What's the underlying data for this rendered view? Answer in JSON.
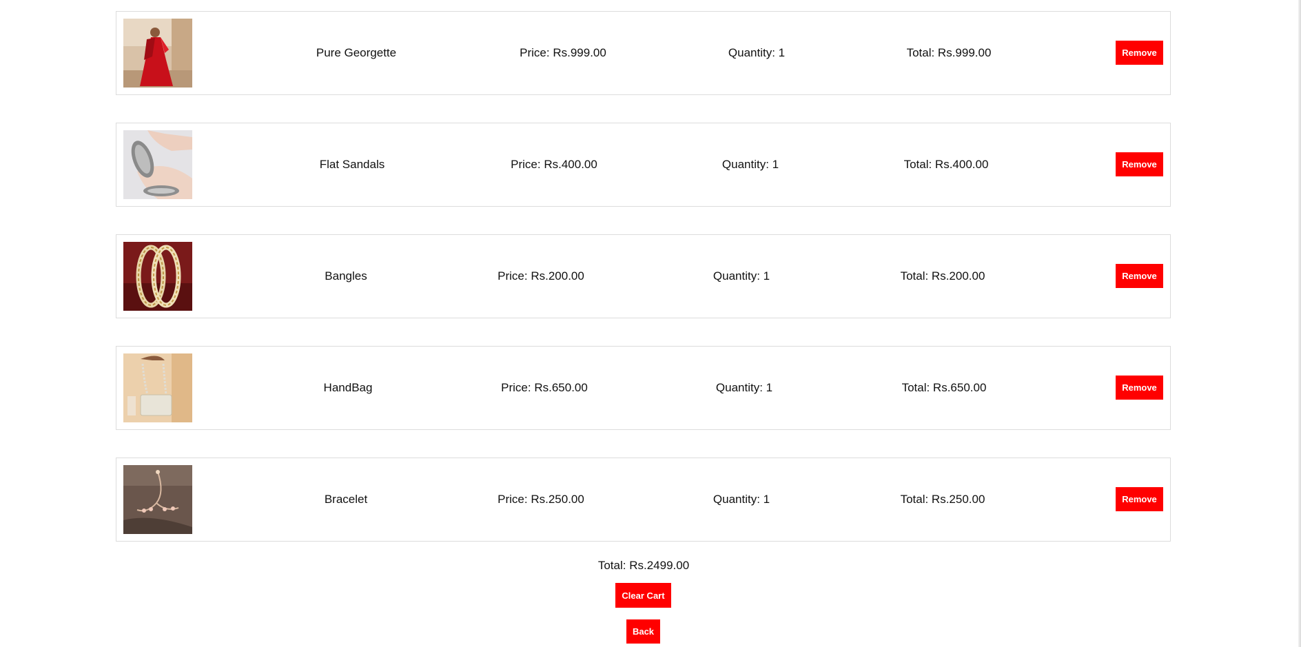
{
  "cart": {
    "items": [
      {
        "image_icon": "saree-photo-icon",
        "name": "Pure Georgette",
        "price": "Price: Rs.999.00",
        "quantity": "Quantity: 1",
        "total": "Total: Rs.999.00",
        "remove_label": "Remove"
      },
      {
        "image_icon": "sandals-photo-icon",
        "name": "Flat Sandals",
        "price": "Price: Rs.400.00",
        "quantity": "Quantity: 1",
        "total": "Total: Rs.400.00",
        "remove_label": "Remove"
      },
      {
        "image_icon": "bangles-photo-icon",
        "name": "Bangles",
        "price": "Price: Rs.200.00",
        "quantity": "Quantity: 1",
        "total": "Total: Rs.200.00",
        "remove_label": "Remove"
      },
      {
        "image_icon": "handbag-photo-icon",
        "name": "HandBag",
        "price": "Price: Rs.650.00",
        "quantity": "Quantity: 1",
        "total": "Total: Rs.650.00",
        "remove_label": "Remove"
      },
      {
        "image_icon": "bracelet-photo-icon",
        "name": "Bracelet",
        "price": "Price: Rs.250.00",
        "quantity": "Quantity: 1",
        "total": "Total: Rs.250.00",
        "remove_label": "Remove"
      }
    ],
    "grand_total": "Total: Rs.2499.00",
    "clear_label": "Clear Cart",
    "back_label": "Back"
  },
  "colors": {
    "button_bg": "#ff0000",
    "button_text": "#ffffff",
    "border": "#dcdcdc"
  }
}
